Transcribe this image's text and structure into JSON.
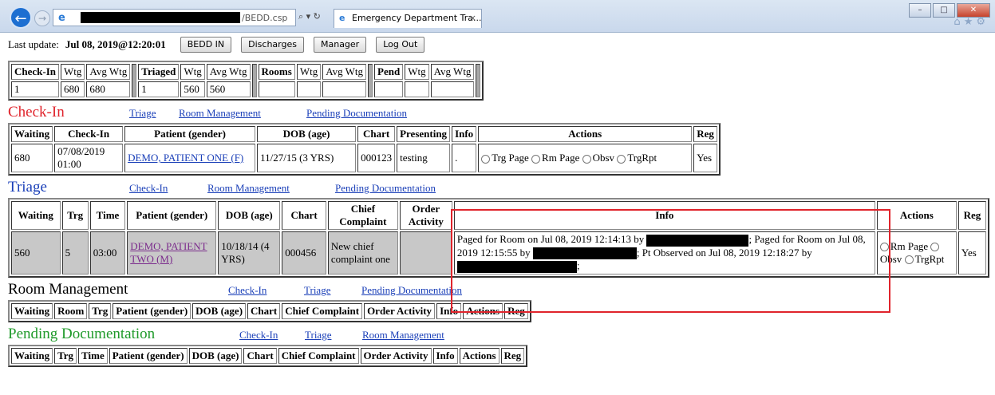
{
  "browser": {
    "url_suffix": "/BEDD.csp",
    "tab_title": "Emergency Department Tra...",
    "tab_close": "×",
    "address_tools": "⌕ ▾ ↻"
  },
  "header": {
    "last_update_label": "Last update:",
    "last_update_value": "Jul 08, 2019@12:20:01",
    "buttons": [
      "BEDD IN",
      "Discharges",
      "Manager",
      "Log Out"
    ]
  },
  "summary": {
    "groups": [
      {
        "title": "Check-In",
        "wtg": "Wtg",
        "avg": "Avg Wtg",
        "count": "1",
        "wtg_val": "680",
        "avg_val": "680"
      },
      {
        "title": "Triaged",
        "wtg": "Wtg",
        "avg": "Avg Wtg",
        "count": "1",
        "wtg_val": "560",
        "avg_val": "560"
      },
      {
        "title": "Rooms",
        "wtg": "Wtg",
        "avg": "Avg Wtg",
        "count": "",
        "wtg_val": "",
        "avg_val": ""
      },
      {
        "title": "Pend",
        "wtg": "Wtg",
        "avg": "Avg Wtg",
        "count": "",
        "wtg_val": "",
        "avg_val": ""
      }
    ]
  },
  "checkin": {
    "title": "Check-In",
    "title_color": "#e0242c",
    "links": [
      "Triage",
      "Room Management",
      "Pending Documentation"
    ],
    "columns": [
      "Waiting",
      "Check-In",
      "Patient (gender)",
      "DOB (age)",
      "Chart",
      "Presenting",
      "Info",
      "Actions",
      "Reg"
    ],
    "row": {
      "waiting": "680",
      "checkin": "07/08/2019 01:00",
      "patient": "DEMO, PATIENT ONE (F)",
      "dob": "11/27/15 (3 YRS)",
      "chart": "000123",
      "presenting": "testing",
      "info": ".",
      "actions": [
        "Trg Page",
        "Rm Page",
        "Obsv",
        "TrgRpt"
      ],
      "reg": "Yes"
    }
  },
  "triage": {
    "title": "Triage",
    "title_color": "#1a3fb8",
    "links": [
      "Check-In",
      "Room Management",
      "Pending Documentation"
    ],
    "columns": [
      "Waiting",
      "Trg",
      "Time",
      "Patient (gender)",
      "DOB (age)",
      "Chart",
      "Chief Complaint",
      "Order Activity",
      "Info",
      "Actions",
      "Reg"
    ],
    "row": {
      "waiting": "560",
      "trg": "5",
      "time": "03:00",
      "patient": "DEMO, PATIENT TWO (M)",
      "dob": "10/18/14 (4 YRS)",
      "chart": "000456",
      "complaint": "New chief complaint one",
      "order": "",
      "info_1": "Paged for Room on Jul 08, 2019 12:14:13 by",
      "info_2": "; Paged for Room on Jul 08, 2019 12:15:55 by",
      "info_3": "; Pt Observed on Jul 08, 2019 12:18:27 by",
      "info_4": ";",
      "actions": [
        "Rm Page",
        "Obsv",
        "TrgRpt"
      ],
      "reg": "Yes"
    }
  },
  "room_mgmt": {
    "title": "Room Management",
    "links": [
      "Check-In",
      "Triage",
      "Pending Documentation"
    ],
    "columns": [
      "Waiting",
      "Room",
      "Trg",
      "Patient (gender)",
      "DOB (age)",
      "Chart",
      "Chief Complaint",
      "Order Activity",
      "Info",
      "Actions",
      "Reg"
    ]
  },
  "pending": {
    "title": "Pending Documentation",
    "title_color": "#1f9a2a",
    "links": [
      "Check-In",
      "Triage",
      "Room Management"
    ],
    "columns": [
      "Waiting",
      "Trg",
      "Time",
      "Patient (gender)",
      "DOB (age)",
      "Chart",
      "Chief Complaint",
      "Order Activity",
      "Info",
      "Actions",
      "Reg"
    ]
  }
}
